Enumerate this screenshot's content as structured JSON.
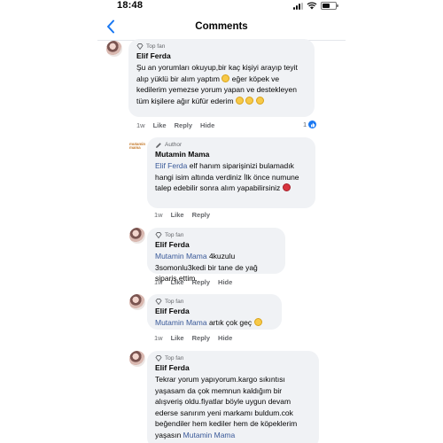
{
  "status": {
    "time": "18:48"
  },
  "header": {
    "title": "Comments"
  },
  "comments": [
    {
      "badge": "Top fan",
      "author": "Elif Ferda",
      "text": "Şu an yorumları okuyup,bir kaç kişiyi arayıp teyit alıp yüklü bir alım yaptım",
      "text2": "eğer köpek ve kedilerim yemezse yorum yapan ve destekleyen tüm kişilere ağır küfür ederim",
      "time": "1w",
      "like": "Like",
      "reply": "Reply",
      "hide": "Hide",
      "reaction_count": "1"
    },
    {
      "badge": "Author",
      "author": "Mutamin Mama",
      "mention": "Elif Ferda",
      "text": "elf hanım siparişinizi bulamadık hangi isim altında verdiniz İlk önce numune talep edebilir sonra alım yapabilirsiniz",
      "time": "1w",
      "like": "Like",
      "reply": "Reply",
      "logo": "mutamin mama"
    },
    {
      "badge": "Top fan",
      "author": "Elif Ferda",
      "mention": "Mutamin Mama",
      "text": "4kuzulu 3somonlu3kedi bir tane de yağ sipariş ettim.",
      "time": "1w",
      "like": "Like",
      "reply": "Reply",
      "hide": "Hide"
    },
    {
      "badge": "Top fan",
      "author": "Elif Ferda",
      "mention": "Mutamin Mama",
      "text": "artık çok geç",
      "time": "1w",
      "like": "Like",
      "reply": "Reply",
      "hide": "Hide"
    },
    {
      "badge": "Top fan",
      "author": "Elif Ferda",
      "text": "Tekrar yorum yapıyorum.kargo sıkıntısı yaşasam da çok memnun kaldığım bir alışveriş oldu.fiyatlar böyle uygun devam ederse sanırım yeni markamı buldum.cok beğendiler hem kediler hem de köpeklerim yaşasın",
      "mention": "Mutamin Mama"
    }
  ],
  "colors": {
    "mention": "#385898",
    "bubble": "#f0f2f5",
    "like_blue": "#1877f2"
  }
}
